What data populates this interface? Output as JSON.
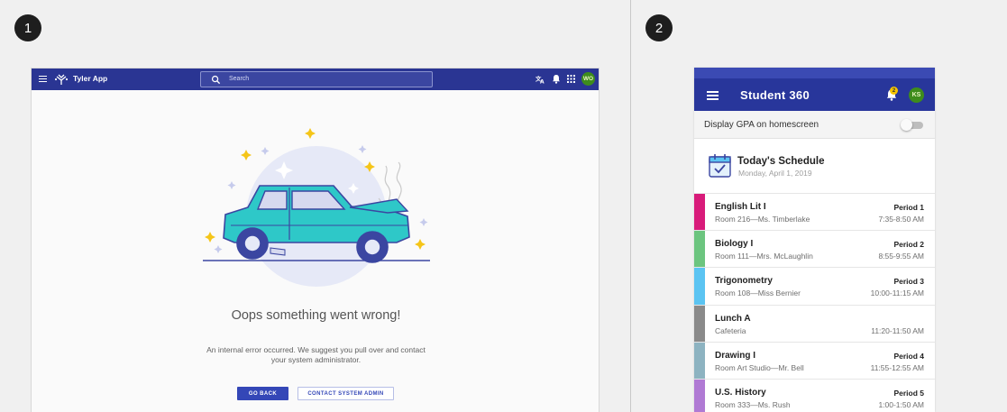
{
  "step_labels": [
    "1",
    "2"
  ],
  "desktop": {
    "app_title": "Tyler App",
    "search_placeholder": "Search",
    "avatar_initials": "WO",
    "error_title": "Oops something went wrong!",
    "error_message_line1": "An internal error occurred. We suggest you pull over and contact",
    "error_message_line2": "your system administrator.",
    "go_back_label": "GO BACK",
    "contact_admin_label": "CONTACT SYSTEM ADMIN",
    "brand_color": "#2a3593"
  },
  "mobile": {
    "app_title": "Student 360",
    "notification_count": "2",
    "avatar_initials": "KS",
    "gpa_toggle_label": "Display GPA on homescreen",
    "gpa_toggle_on": false,
    "schedule_title": "Today's Schedule",
    "schedule_date": "Monday, April 1, 2019",
    "classes": [
      {
        "name": "English Lit I",
        "room": "Room 216—Ms. Timberlake",
        "period": "Period 1",
        "time": "7:35-8:50 AM",
        "color": "#d81b7a"
      },
      {
        "name": "Biology I",
        "room": "Room 111—Mrs. McLaughlin",
        "period": "Period 2",
        "time": "8:55-9:55 AM",
        "color": "#6cc57f"
      },
      {
        "name": "Trigonometry",
        "room": "Room 108—Miss Bernier",
        "period": "Period 3",
        "time": "10:00-11:15 AM",
        "color": "#5bc4f2"
      },
      {
        "name": "Lunch A",
        "room": "Cafeteria",
        "period": "",
        "time": "11:20-11:50 AM",
        "color": "#8a8a8a"
      },
      {
        "name": "Drawing I",
        "room": "Room Art Studio—Mr. Bell",
        "period": "Period 4",
        "time": "11:55-12:55 AM",
        "color": "#8db3c1"
      },
      {
        "name": "U.S. History",
        "room": "Room 333—Ms. Rush",
        "period": "Period 5",
        "time": "1:00-1:50 AM",
        "color": "#b07ad4"
      }
    ]
  }
}
